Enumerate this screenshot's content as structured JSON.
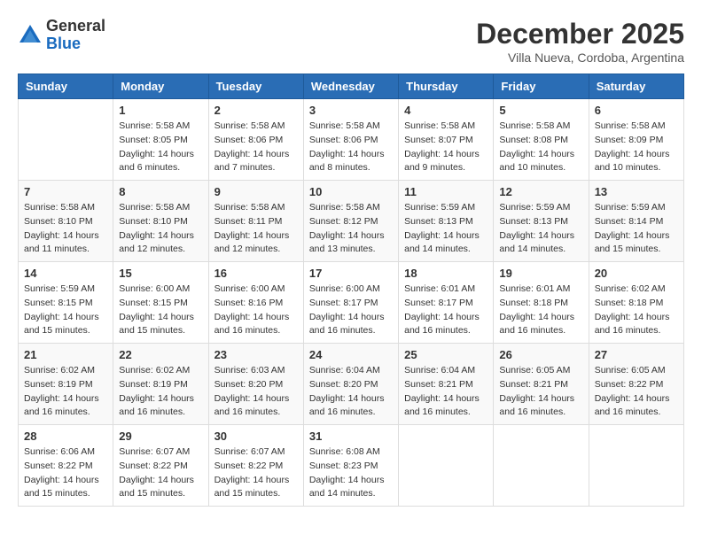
{
  "logo": {
    "general": "General",
    "blue": "Blue"
  },
  "title": "December 2025",
  "subtitle": "Villa Nueva, Cordoba, Argentina",
  "weekdays": [
    "Sunday",
    "Monday",
    "Tuesday",
    "Wednesday",
    "Thursday",
    "Friday",
    "Saturday"
  ],
  "weeks": [
    [
      {
        "day": "",
        "info": ""
      },
      {
        "day": "1",
        "info": "Sunrise: 5:58 AM\nSunset: 8:05 PM\nDaylight: 14 hours\nand 6 minutes."
      },
      {
        "day": "2",
        "info": "Sunrise: 5:58 AM\nSunset: 8:06 PM\nDaylight: 14 hours\nand 7 minutes."
      },
      {
        "day": "3",
        "info": "Sunrise: 5:58 AM\nSunset: 8:06 PM\nDaylight: 14 hours\nand 8 minutes."
      },
      {
        "day": "4",
        "info": "Sunrise: 5:58 AM\nSunset: 8:07 PM\nDaylight: 14 hours\nand 9 minutes."
      },
      {
        "day": "5",
        "info": "Sunrise: 5:58 AM\nSunset: 8:08 PM\nDaylight: 14 hours\nand 10 minutes."
      },
      {
        "day": "6",
        "info": "Sunrise: 5:58 AM\nSunset: 8:09 PM\nDaylight: 14 hours\nand 10 minutes."
      }
    ],
    [
      {
        "day": "7",
        "info": "Sunrise: 5:58 AM\nSunset: 8:10 PM\nDaylight: 14 hours\nand 11 minutes."
      },
      {
        "day": "8",
        "info": "Sunrise: 5:58 AM\nSunset: 8:10 PM\nDaylight: 14 hours\nand 12 minutes."
      },
      {
        "day": "9",
        "info": "Sunrise: 5:58 AM\nSunset: 8:11 PM\nDaylight: 14 hours\nand 12 minutes."
      },
      {
        "day": "10",
        "info": "Sunrise: 5:58 AM\nSunset: 8:12 PM\nDaylight: 14 hours\nand 13 minutes."
      },
      {
        "day": "11",
        "info": "Sunrise: 5:59 AM\nSunset: 8:13 PM\nDaylight: 14 hours\nand 14 minutes."
      },
      {
        "day": "12",
        "info": "Sunrise: 5:59 AM\nSunset: 8:13 PM\nDaylight: 14 hours\nand 14 minutes."
      },
      {
        "day": "13",
        "info": "Sunrise: 5:59 AM\nSunset: 8:14 PM\nDaylight: 14 hours\nand 15 minutes."
      }
    ],
    [
      {
        "day": "14",
        "info": "Sunrise: 5:59 AM\nSunset: 8:15 PM\nDaylight: 14 hours\nand 15 minutes."
      },
      {
        "day": "15",
        "info": "Sunrise: 6:00 AM\nSunset: 8:15 PM\nDaylight: 14 hours\nand 15 minutes."
      },
      {
        "day": "16",
        "info": "Sunrise: 6:00 AM\nSunset: 8:16 PM\nDaylight: 14 hours\nand 16 minutes."
      },
      {
        "day": "17",
        "info": "Sunrise: 6:00 AM\nSunset: 8:17 PM\nDaylight: 14 hours\nand 16 minutes."
      },
      {
        "day": "18",
        "info": "Sunrise: 6:01 AM\nSunset: 8:17 PM\nDaylight: 14 hours\nand 16 minutes."
      },
      {
        "day": "19",
        "info": "Sunrise: 6:01 AM\nSunset: 8:18 PM\nDaylight: 14 hours\nand 16 minutes."
      },
      {
        "day": "20",
        "info": "Sunrise: 6:02 AM\nSunset: 8:18 PM\nDaylight: 14 hours\nand 16 minutes."
      }
    ],
    [
      {
        "day": "21",
        "info": "Sunrise: 6:02 AM\nSunset: 8:19 PM\nDaylight: 14 hours\nand 16 minutes."
      },
      {
        "day": "22",
        "info": "Sunrise: 6:02 AM\nSunset: 8:19 PM\nDaylight: 14 hours\nand 16 minutes."
      },
      {
        "day": "23",
        "info": "Sunrise: 6:03 AM\nSunset: 8:20 PM\nDaylight: 14 hours\nand 16 minutes."
      },
      {
        "day": "24",
        "info": "Sunrise: 6:04 AM\nSunset: 8:20 PM\nDaylight: 14 hours\nand 16 minutes."
      },
      {
        "day": "25",
        "info": "Sunrise: 6:04 AM\nSunset: 8:21 PM\nDaylight: 14 hours\nand 16 minutes."
      },
      {
        "day": "26",
        "info": "Sunrise: 6:05 AM\nSunset: 8:21 PM\nDaylight: 14 hours\nand 16 minutes."
      },
      {
        "day": "27",
        "info": "Sunrise: 6:05 AM\nSunset: 8:22 PM\nDaylight: 14 hours\nand 16 minutes."
      }
    ],
    [
      {
        "day": "28",
        "info": "Sunrise: 6:06 AM\nSunset: 8:22 PM\nDaylight: 14 hours\nand 15 minutes."
      },
      {
        "day": "29",
        "info": "Sunrise: 6:07 AM\nSunset: 8:22 PM\nDaylight: 14 hours\nand 15 minutes."
      },
      {
        "day": "30",
        "info": "Sunrise: 6:07 AM\nSunset: 8:22 PM\nDaylight: 14 hours\nand 15 minutes."
      },
      {
        "day": "31",
        "info": "Sunrise: 6:08 AM\nSunset: 8:23 PM\nDaylight: 14 hours\nand 14 minutes."
      },
      {
        "day": "",
        "info": ""
      },
      {
        "day": "",
        "info": ""
      },
      {
        "day": "",
        "info": ""
      }
    ]
  ]
}
